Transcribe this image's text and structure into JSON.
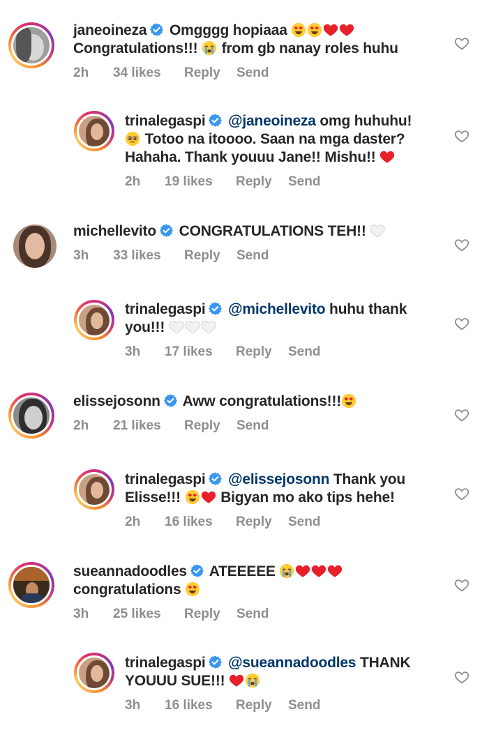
{
  "comments": [
    {
      "username": "janeoineza",
      "mention": "",
      "line1": "Omgggg hopiaaa",
      "line2": "Congratulations!!!",
      "line2b": "from gb nanay roles huhu",
      "time": "2h",
      "likes": "34 likes",
      "reply": "Reply",
      "send": "Send"
    },
    {
      "username": "trinalegaspi",
      "mention": "@janeoineza",
      "line1": "omg huhuhu!",
      "line2": "Totoo na itoooo. Saan na mga daster?",
      "line3": "Hahaha. Thank youuu Jane!! Mishu!!",
      "time": "2h",
      "likes": "19 likes",
      "reply": "Reply",
      "send": "Send"
    },
    {
      "username": "michellevito",
      "mention": "",
      "line1": "CONGRATULATIONS TEH!!",
      "time": "3h",
      "likes": "33 likes",
      "reply": "Reply",
      "send": "Send"
    },
    {
      "username": "trinalegaspi",
      "mention": "@michellevito",
      "line1": "huhu thank",
      "line2": "you!!!",
      "time": "3h",
      "likes": "17 likes",
      "reply": "Reply",
      "send": "Send"
    },
    {
      "username": "elissejosonn",
      "mention": "",
      "line1": "Aww congratulations!!!",
      "time": "2h",
      "likes": "21 likes",
      "reply": "Reply",
      "send": "Send"
    },
    {
      "username": "trinalegaspi",
      "mention": "@elissejosonn",
      "line1": "Thank you",
      "line2": "Elisse!!!",
      "line2b": "Bigyan mo ako tips hehe!",
      "time": "2h",
      "likes": "16 likes",
      "reply": "Reply",
      "send": "Send"
    },
    {
      "username": "sueannadoodles",
      "mention": "",
      "line1": "ATEEEEE",
      "line2": "congratulations",
      "time": "3h",
      "likes": "25 likes",
      "reply": "Reply",
      "send": "Send"
    },
    {
      "username": "trinalegaspi",
      "mention": "@sueannadoodles",
      "line1": "THANK",
      "line2": "YOUUU SUE!!!",
      "time": "3h",
      "likes": "16 likes",
      "reply": "Reply",
      "send": "Send"
    }
  ],
  "colors": {
    "text": "#262626",
    "meta": "#8e8e8e",
    "mention": "#00376b",
    "verified": "#3897f0",
    "heart_red": "#ed1c24"
  }
}
